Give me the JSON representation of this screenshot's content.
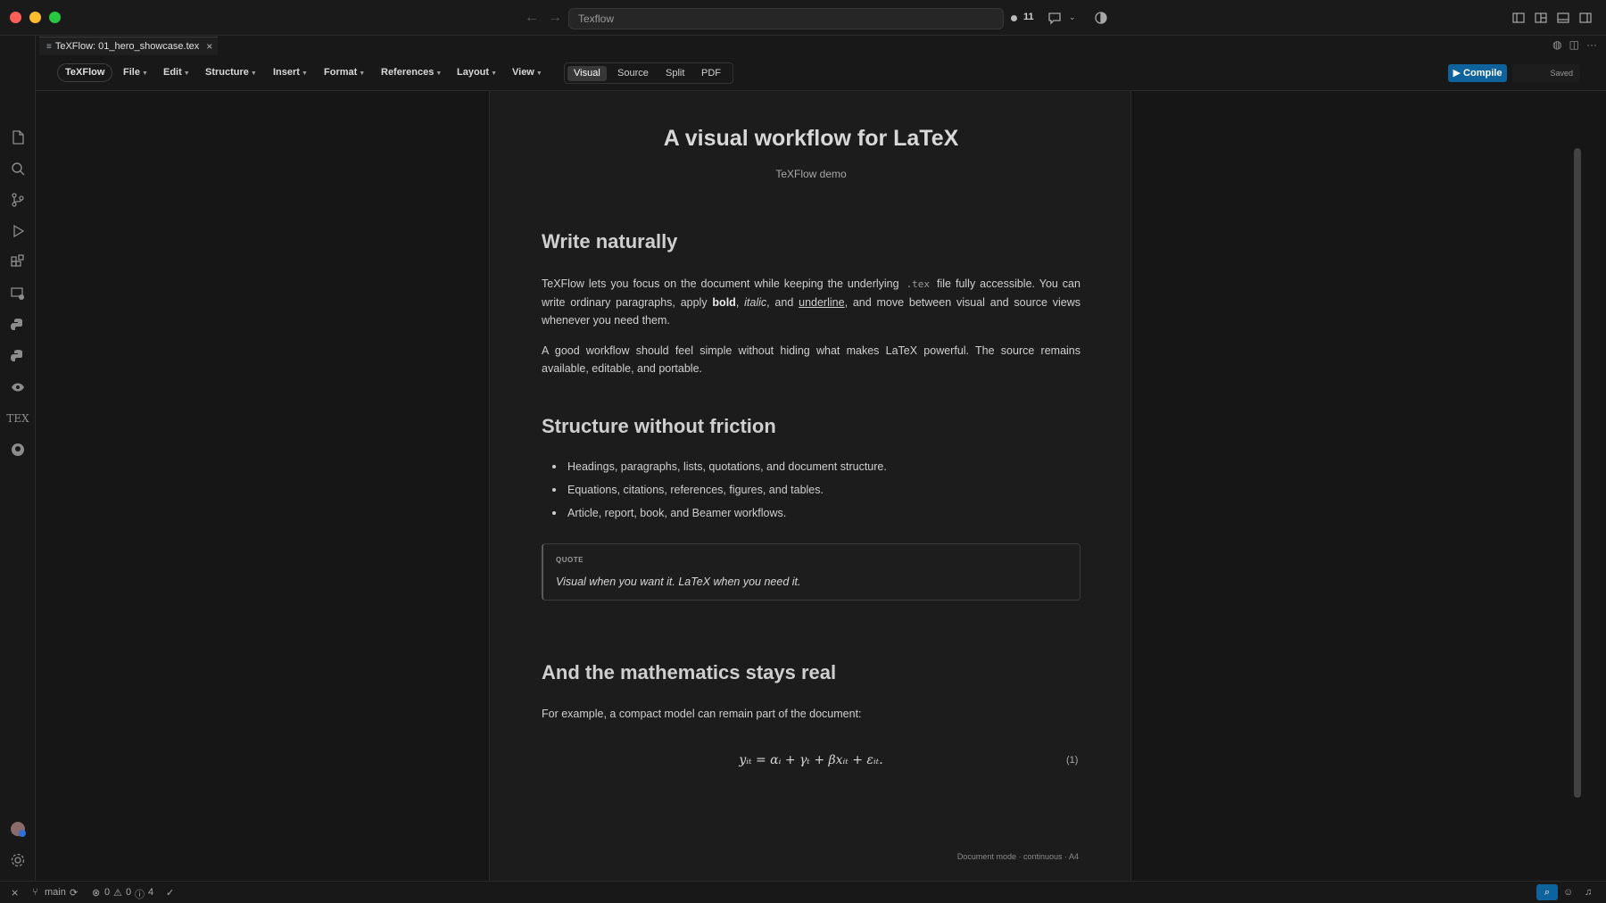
{
  "window": {
    "title": "Texflow",
    "notification_count": "11"
  },
  "tab": {
    "label": "TeXFlow: 01_hero_showcase.tex"
  },
  "toolbar": {
    "brand": "TeXFlow",
    "menus": [
      "File",
      "Edit",
      "Structure",
      "Insert",
      "Format",
      "References",
      "Layout",
      "View"
    ],
    "views": [
      "Visual",
      "Source",
      "Split",
      "PDF"
    ],
    "active_view": "Visual",
    "compile_label": "▶ Compile",
    "saved_label": "Saved"
  },
  "document": {
    "title": "A visual workflow for LaTeX",
    "subtitle": "TeXFlow demo",
    "section1": {
      "heading": "Write naturally",
      "p1_a": "TeXFlow lets you focus on the document while keeping the underlying",
      "p1_code": ".tex",
      "p1_b": "file fully accessible. You can write ordinary paragraphs, apply",
      "p1_bold": "bold",
      "p1_c": ",",
      "p1_italic": "italic",
      "p1_d": ", and",
      "p1_underline": "underline",
      "p1_e": ", and move between visual and source views whenever you need them.",
      "p2": "A good workflow should feel simple without hiding what makes LaTeX powerful. The source remains available, editable, and portable."
    },
    "section2": {
      "heading": "Structure without friction",
      "bullets": [
        "Headings, paragraphs, lists, quotations, and document structure.",
        "Equations, citations, references, figures, and tables.",
        "Article, report, book, and Beamer workflows."
      ],
      "quote_label": "QUOTE",
      "quote_text": "Visual when you want it. LaTeX when you need it."
    },
    "section3": {
      "heading": "And the mathematics stays real",
      "p1": "For example, a compact model can remain part of the document:",
      "equation": "yᵢₜ = αᵢ + γₜ + βxᵢₜ + εᵢₜ.",
      "equation_number": "(1)"
    },
    "footer": "Document mode · continuous · A4"
  },
  "statusbar": {
    "branch": "main",
    "errors": "0",
    "warnings": "0",
    "infos": "4"
  },
  "colors": {
    "accent": "#0e639c",
    "traffic_red": "#fe5f57",
    "traffic_yellow": "#febc2e",
    "traffic_green": "#28c840"
  },
  "icons": {
    "activity_bar": [
      "explorer-icon",
      "search-icon",
      "source-control-icon",
      "run-debug-icon",
      "extensions-icon",
      "remote-explorer-icon",
      "python-icon",
      "python-env-icon",
      "testing-icon",
      "tex-icon",
      "github-icon"
    ]
  }
}
